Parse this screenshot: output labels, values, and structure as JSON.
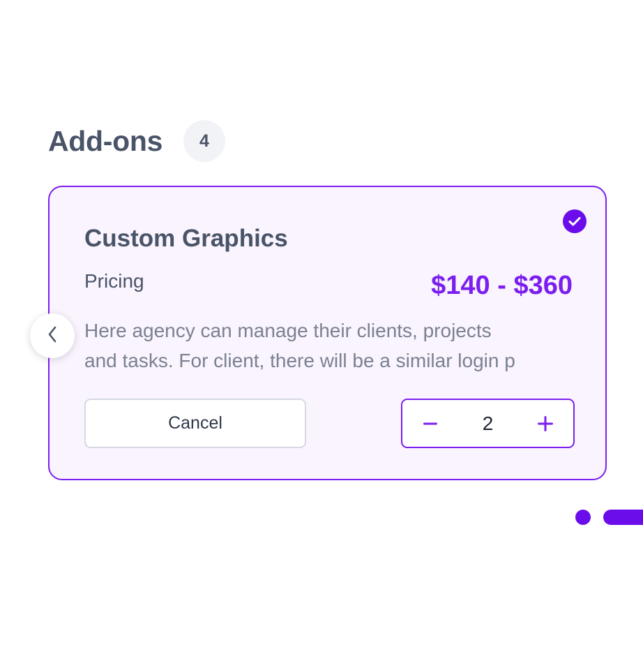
{
  "header": {
    "title": "Add-ons",
    "count": "4"
  },
  "card": {
    "title": "Custom Graphics",
    "pricing_label": "Pricing",
    "price_range": "$140 - $360",
    "description_lines": [
      "Here agency can manage their clients, projects",
      "and tasks. For client, there will be a similar login p"
    ],
    "cancel_label": "Cancel",
    "quantity": "2",
    "selected": true
  },
  "icons": {
    "selected": "check-circle-icon",
    "minus": "minus-icon",
    "plus": "plus-icon",
    "previous": "chevron-left-icon"
  },
  "pagination": {
    "dots": 2,
    "active_index": 1
  },
  "colors": {
    "accent": "#7b1ef0",
    "accent_dark": "#6a0dea",
    "text_primary": "#4a5468",
    "text_muted": "#7b8191",
    "card_background": "#f9f4fd",
    "badge_background": "#f2f3f6"
  }
}
